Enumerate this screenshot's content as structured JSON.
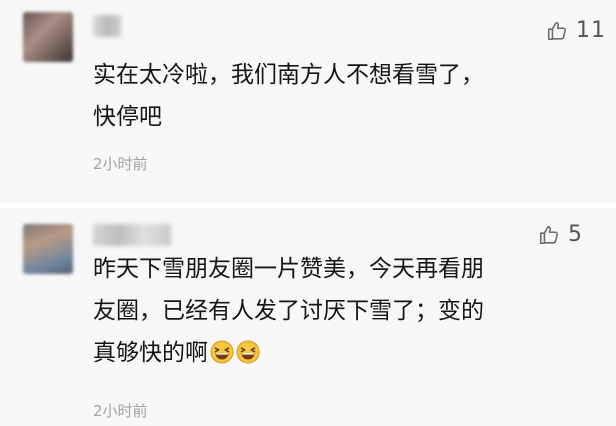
{
  "comments": [
    {
      "likes": "11",
      "text_lines": [
        "实在太冷啦，我们南方人不想看雪了，",
        "快停吧"
      ],
      "time": "2小时前"
    },
    {
      "likes": "5",
      "text_lines": [
        "昨天下雪朋友圈一片赞美，今天再看朋",
        "友圈，已经有人发了讨厌下雪了；变的",
        "真够快的啊"
      ],
      "emojis": [
        "grinning-squint-emoji",
        "grinning-squint-emoji"
      ],
      "time": "2小时前"
    }
  ]
}
